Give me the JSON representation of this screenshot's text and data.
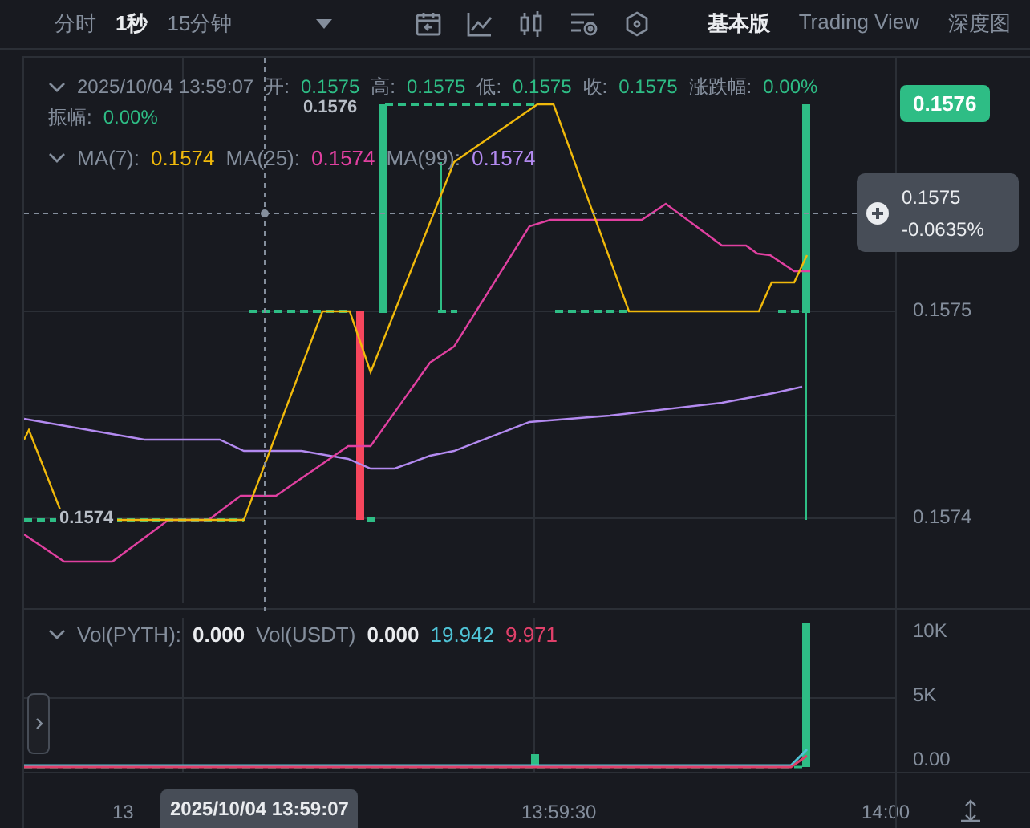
{
  "toolbar": {
    "intervals": [
      {
        "label": "分时",
        "selected": false
      },
      {
        "label": "1秒",
        "selected": true
      },
      {
        "label": "15分钟",
        "selected": false
      }
    ],
    "views": [
      {
        "label": "基本版",
        "selected": true
      },
      {
        "label": "Trading View",
        "selected": false
      },
      {
        "label": "深度图",
        "selected": false
      }
    ]
  },
  "legend": {
    "datetime": "2025/10/04 13:59:07",
    "fields": [
      {
        "label": "开:",
        "value": "0.1575"
      },
      {
        "label": "高:",
        "value": "0.1575"
      },
      {
        "label": "低:",
        "value": "0.1575"
      },
      {
        "label": "收:",
        "value": "0.1575"
      },
      {
        "label": "涨跌幅:",
        "value": "0.00%"
      },
      {
        "label": "振幅:",
        "value": "0.00%"
      }
    ],
    "ma": [
      {
        "label": "MA(7):",
        "value": "0.1574",
        "color": "#f0b90b"
      },
      {
        "label": "MA(25):",
        "value": "0.1574",
        "color": "#e040a0"
      },
      {
        "label": "MA(99):",
        "value": "0.1574",
        "color": "#b38af0"
      }
    ]
  },
  "markers": {
    "high": "0.1576",
    "low": "0.1574"
  },
  "price_axis": {
    "current_price": "0.1576",
    "crosshair_price": "0.1575",
    "crosshair_change": "-0.0635%",
    "ticks": [
      "0.1575",
      "0.1574"
    ]
  },
  "volume": {
    "items": [
      {
        "label": "Vol(PYTH):",
        "value": "0.000"
      },
      {
        "label": "Vol(USDT)",
        "value": "0.000"
      }
    ],
    "ma_values": [
      {
        "value": "19.942",
        "color": "#4fc3d6"
      },
      {
        "value": "9.971",
        "color": "#e0406a"
      }
    ],
    "ticks": [
      "10K",
      "5K",
      "0.00"
    ]
  },
  "time_axis": {
    "labels": [
      "13",
      "13:59:30",
      "14:00"
    ],
    "crosshair_time": "2025/10/04 13:59:07"
  }
}
